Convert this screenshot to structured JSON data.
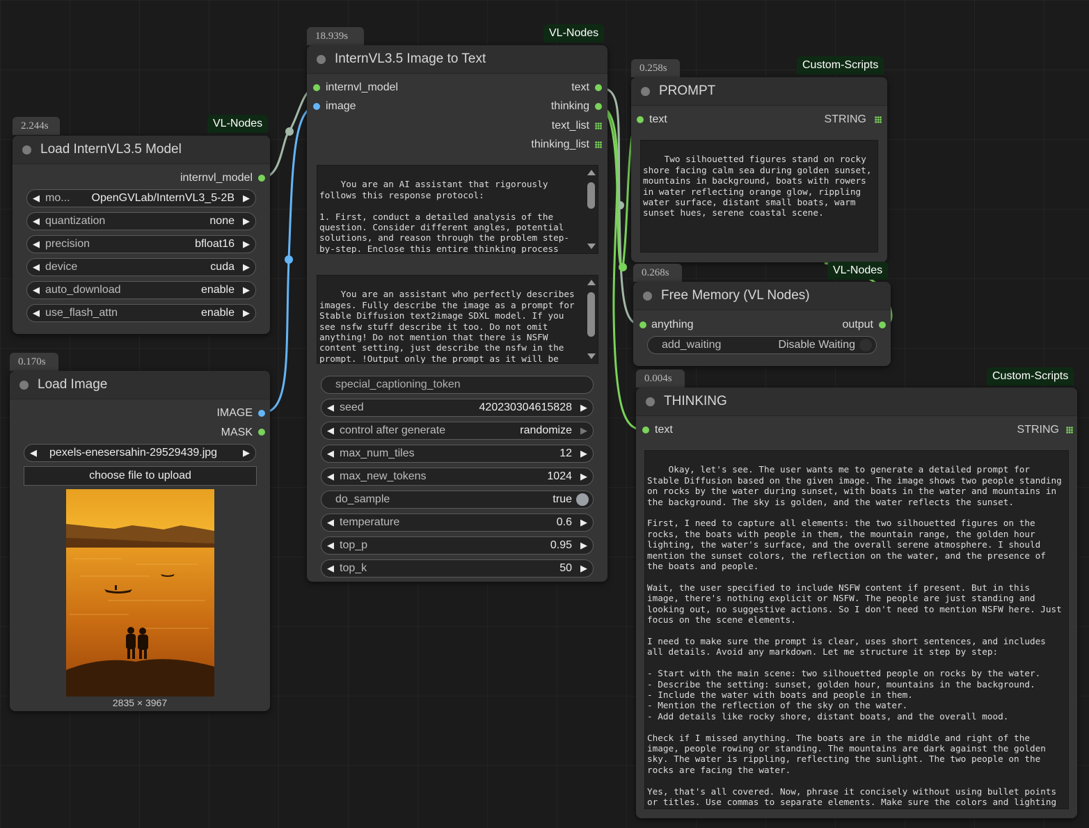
{
  "colors": {
    "canvas": "#1b1b1b",
    "node": "#353535",
    "wire_green": "#7ad35a",
    "wire_blue": "#64b5f6",
    "wire_gray": "#a3b8a8",
    "badge": "#0f2a14"
  },
  "load_model": {
    "time": "2.244s",
    "badge": "VL-Nodes",
    "title": "Load InternVL3.5 Model",
    "output": "internvl_model",
    "widgets": [
      {
        "label": "mo...",
        "value": "OpenGVLab/InternVL3_5-2B"
      },
      {
        "label": "quantization",
        "value": "none"
      },
      {
        "label": "precision",
        "value": "bfloat16"
      },
      {
        "label": "device",
        "value": "cuda"
      },
      {
        "label": "auto_download",
        "value": "enable"
      },
      {
        "label": "use_flash_attn",
        "value": "enable"
      }
    ]
  },
  "load_image": {
    "time": "0.170s",
    "title": "Load Image",
    "outputs": [
      "IMAGE",
      "MASK"
    ],
    "file": "pexels-enesersahin-29529439.jpg",
    "upload_label": "choose file to upload",
    "dimensions": "2835 × 3967"
  },
  "intern": {
    "time": "18.939s",
    "badge": "VL-Nodes",
    "title": "InternVL3.5 Image to Text",
    "inputs": [
      "internvl_model",
      "image"
    ],
    "outputs": [
      "text",
      "thinking",
      "text_list",
      "thinking_list"
    ],
    "system_prompt": "You are an AI assistant that rigorously follows this response protocol:\n\n1. First, conduct a detailed analysis of the question. Consider different angles, potential solutions, and reason through the problem step-by-step. Enclose this entire thinking process within <think> and  </think> tags.",
    "user_prompt": "You are an assistant who perfectly describes images. Fully describe the image as a prompt for Stable Diffusion text2image SDXL model. If you see nsfw stuff describe it too. Do not omit anything! Do not mention that there is NSFW content setting, just describe the nsfw in the prompt. !Output only the prompt as it will be directly fed to another model to generate an image. Be clear and use short sentences. Describe the colors too.",
    "special_token_placeholder": "special_captioning_token",
    "widgets": [
      {
        "label": "seed",
        "value": "420230304615828",
        "kind": "number"
      },
      {
        "label": "control after generate",
        "value": "randomize",
        "kind": "combo"
      },
      {
        "label": "max_num_tiles",
        "value": "12",
        "kind": "number"
      },
      {
        "label": "max_new_tokens",
        "value": "1024",
        "kind": "number"
      },
      {
        "label": "do_sample",
        "value": "true",
        "kind": "toggle"
      },
      {
        "label": "temperature",
        "value": "0.6",
        "kind": "number"
      },
      {
        "label": "top_p",
        "value": "0.95",
        "kind": "number"
      },
      {
        "label": "top_k",
        "value": "50",
        "kind": "number"
      }
    ]
  },
  "prompt": {
    "time": "0.258s",
    "badge": "Custom-Scripts",
    "title": "PROMPT",
    "input": "text",
    "type": "STRING",
    "text": "Two silhouetted figures stand on rocky shore facing calm sea during golden sunset, mountains in background, boats with rowers in water reflecting orange glow, rippling water surface, distant small boats, warm sunset hues, serene coastal scene."
  },
  "free_memory": {
    "time": "0.268s",
    "badge": "VL-Nodes",
    "title": "Free Memory (VL Nodes)",
    "input": "anything",
    "output": "output",
    "widget_label": "add_waiting",
    "widget_value": "Disable Waiting"
  },
  "thinking": {
    "time": "0.004s",
    "badge": "Custom-Scripts",
    "title": "THINKING",
    "input": "text",
    "type": "STRING",
    "text": "Okay, let's see. The user wants me to generate a detailed prompt for Stable Diffusion based on the given image. The image shows two people standing on rocks by the water during sunset, with boats in the water and mountains in the background. The sky is golden, and the water reflects the sunset.\n\nFirst, I need to capture all elements: the two silhouetted figures on the rocks, the boats with people in them, the mountain range, the golden hour lighting, the water's surface, and the overall serene atmosphere. I should mention the sunset colors, the reflection on the water, and the presence of the boats and people.\n\nWait, the user specified to include NSFW content if present. But in this image, there's nothing explicit or NSFW. The people are just standing and looking out, no suggestive actions. So I don't need to mention NSFW here. Just focus on the scene elements.\n\nI need to make sure the prompt is clear, uses short sentences, and includes all details. Avoid any markdown. Let me structure it step by step:\n\n- Start with the main scene: two silhouetted people on rocks by the water.\n- Describe the setting: sunset, golden hour, mountains in the background.\n- Include the water with boats and people in them.\n- Mention the reflection of the sky on the water.\n- Add details like rocky shore, distant boats, and the overall mood.\n\nCheck if I missed anything. The boats are in the middle and right of the image, people rowing or standing. The mountains are dark against the golden sky. The water is rippling, reflecting the sunlight. The two people on the rocks are facing the water.\n\nYes, that's all covered. Now, phrase it concisely without using bullet points or titles. Use commas to separate elements. Make sure the colors and lighting are emphasized as golden and warm."
  }
}
